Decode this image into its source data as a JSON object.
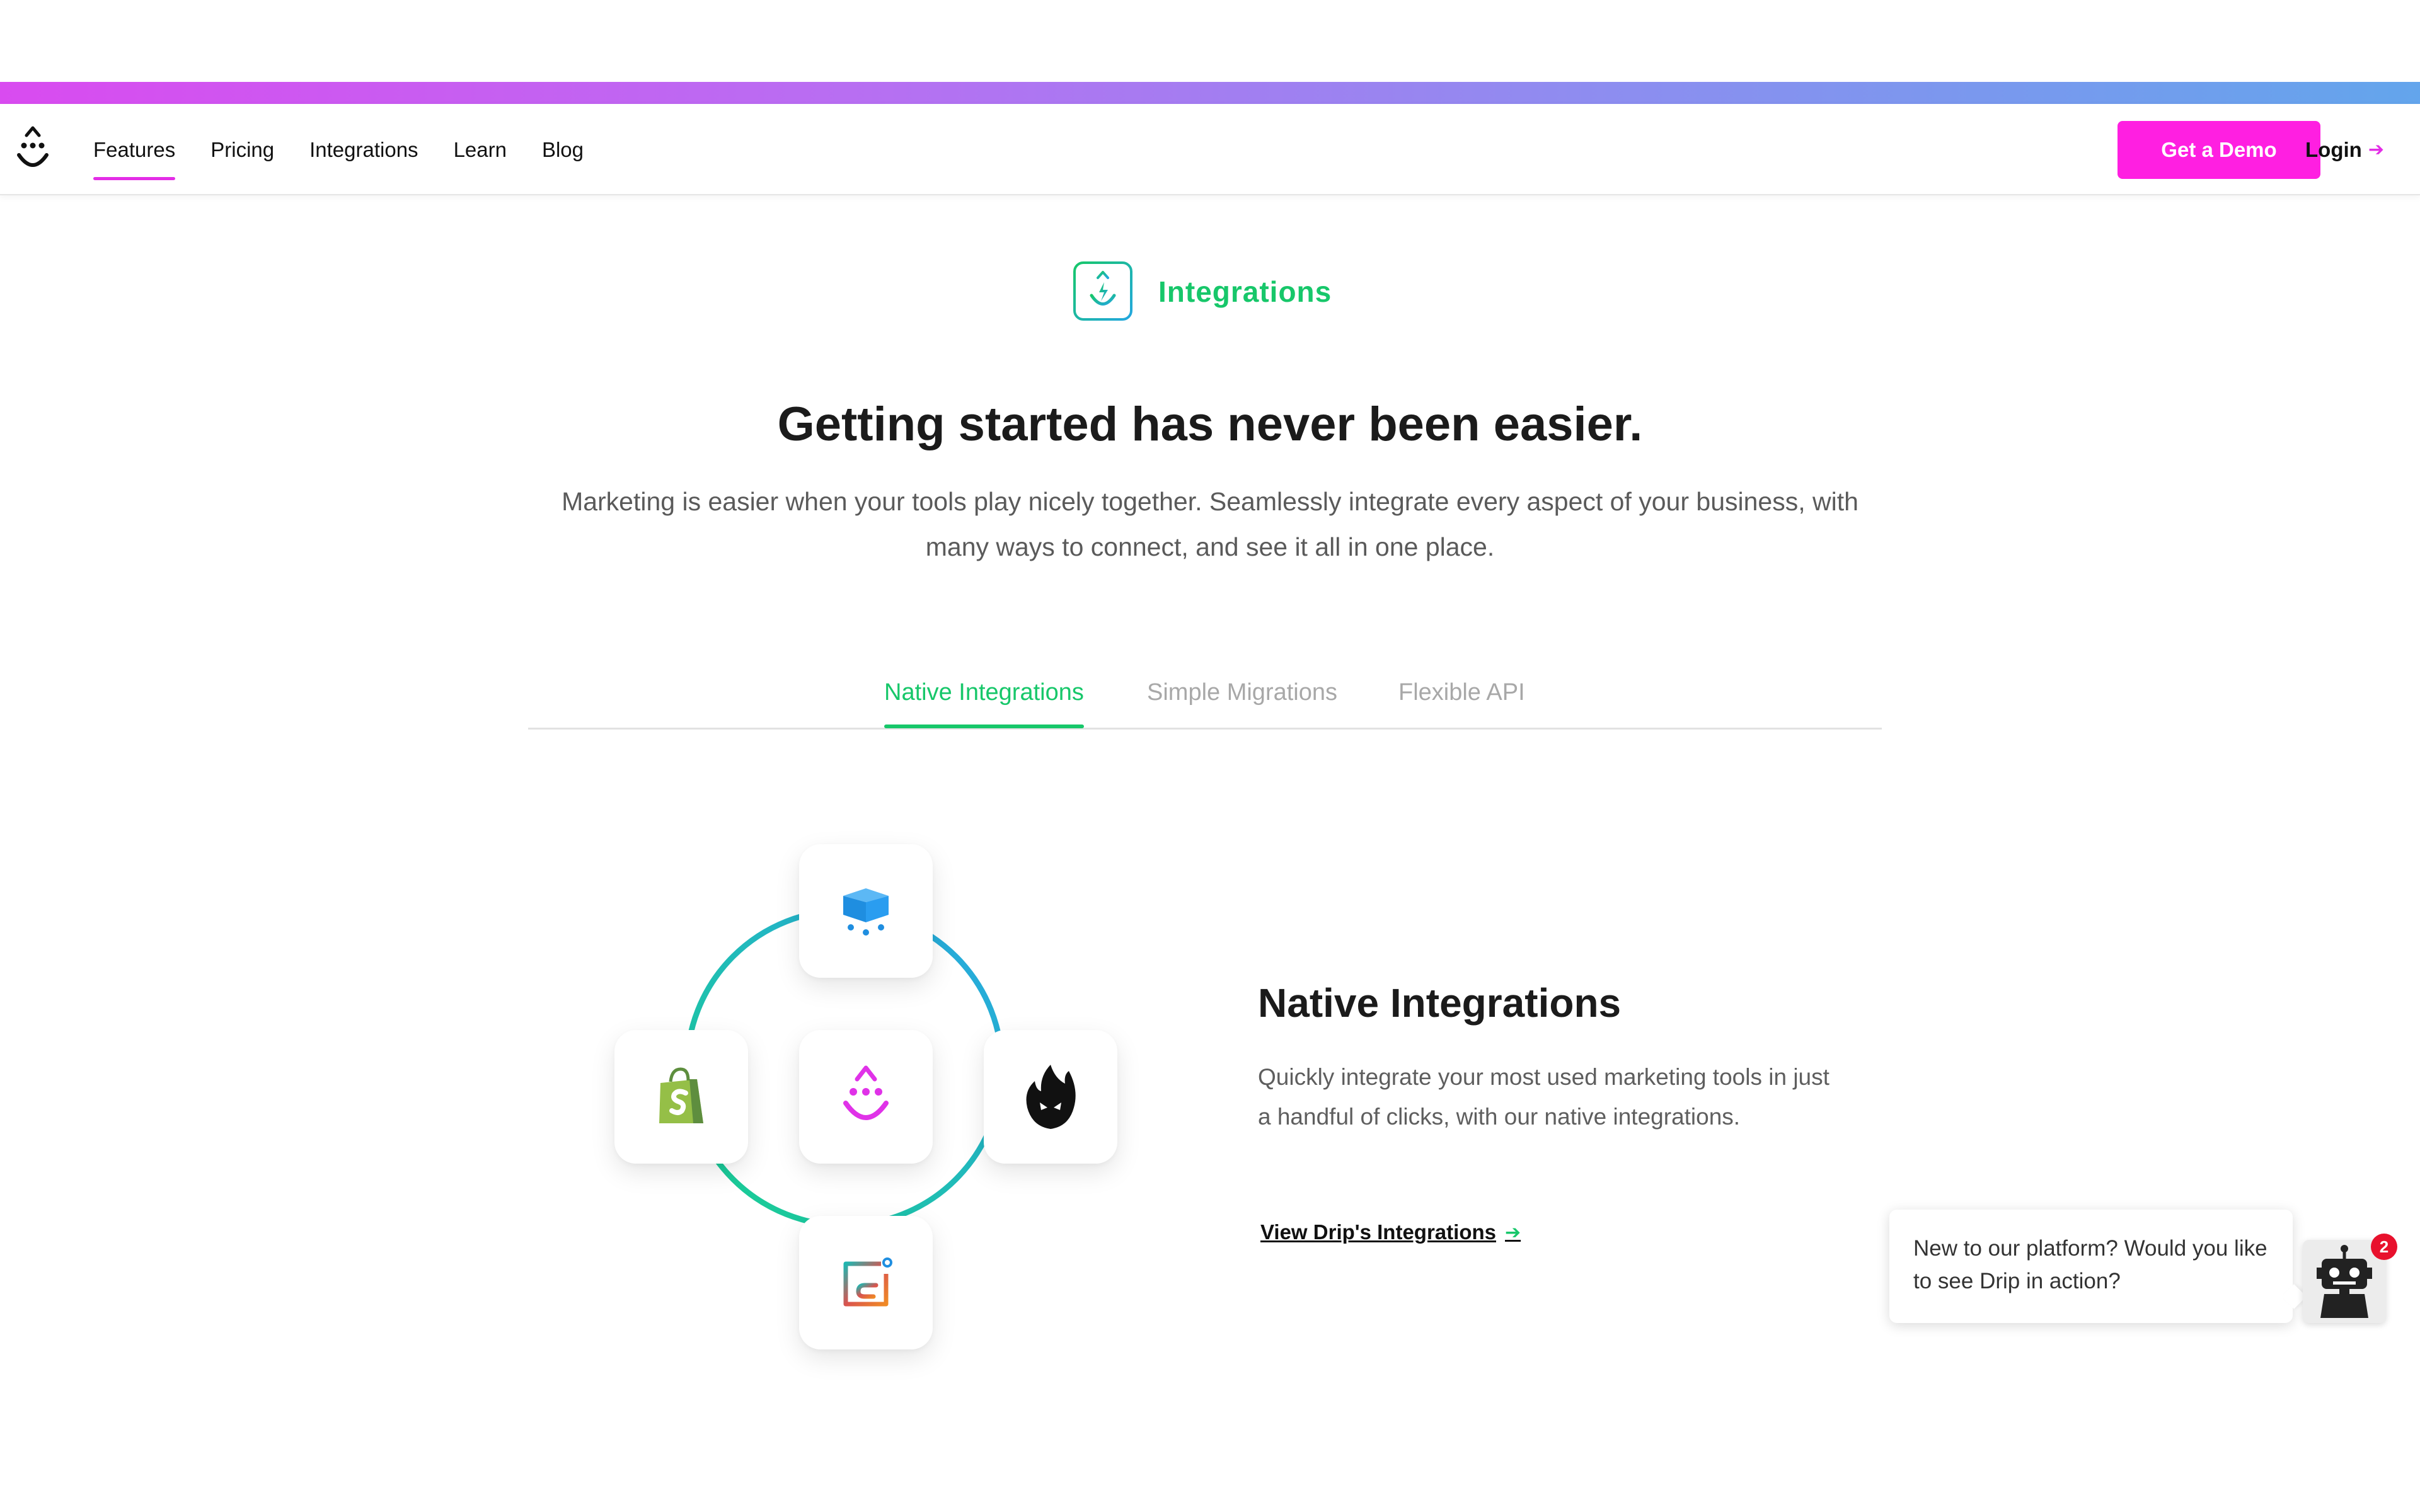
{
  "nav": {
    "links": [
      {
        "label": "Features",
        "active": true
      },
      {
        "label": "Pricing"
      },
      {
        "label": "Integrations"
      },
      {
        "label": "Learn"
      },
      {
        "label": "Blog"
      }
    ],
    "demo_button": "Get a Demo",
    "login_label": "Login",
    "accent_color": "#ff1fe1"
  },
  "section": {
    "label": "Integrations",
    "icon": "drip-bolt-icon",
    "headline": "Getting started has never been easier.",
    "subtext": "Marketing is easier when your tools play nicely together. Seamlessly integrate every aspect of your business, with many ways to connect, and see it all in one place."
  },
  "tabs": [
    {
      "label": "Native Integrations",
      "active": true
    },
    {
      "label": "Simple Migrations",
      "active": false
    },
    {
      "label": "Flexible API",
      "active": false
    }
  ],
  "diagram": {
    "tiles": [
      "cart-icon",
      "shopify-icon",
      "drip-logo-icon",
      "flame-icon",
      "connector-icon"
    ]
  },
  "feature": {
    "title": "Native Integrations",
    "description": "Quickly integrate your most used marketing tools in just a handful of clicks, with our native integrations.",
    "link_label": "View Drip's Integrations"
  },
  "chat": {
    "message": "New to our platform? Would you like to see Drip in action?",
    "badge_count": "2"
  },
  "colors": {
    "green": "#17c76a",
    "magenta": "#ff1fe1",
    "gradient_start": "#d94bf0",
    "gradient_end": "#63a5ec"
  }
}
